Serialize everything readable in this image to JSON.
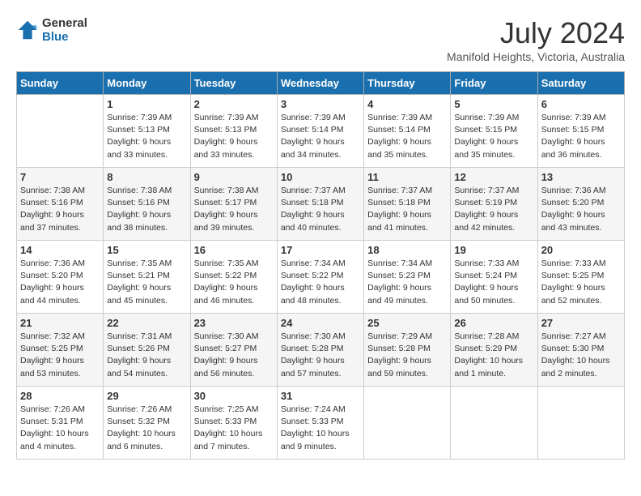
{
  "header": {
    "logo_line1": "General",
    "logo_line2": "Blue",
    "month_year": "July 2024",
    "location": "Manifold Heights, Victoria, Australia"
  },
  "days_of_week": [
    "Sunday",
    "Monday",
    "Tuesday",
    "Wednesday",
    "Thursday",
    "Friday",
    "Saturday"
  ],
  "weeks": [
    [
      {
        "day": "",
        "info": ""
      },
      {
        "day": "1",
        "info": "Sunrise: 7:39 AM\nSunset: 5:13 PM\nDaylight: 9 hours\nand 33 minutes."
      },
      {
        "day": "2",
        "info": "Sunrise: 7:39 AM\nSunset: 5:13 PM\nDaylight: 9 hours\nand 33 minutes."
      },
      {
        "day": "3",
        "info": "Sunrise: 7:39 AM\nSunset: 5:14 PM\nDaylight: 9 hours\nand 34 minutes."
      },
      {
        "day": "4",
        "info": "Sunrise: 7:39 AM\nSunset: 5:14 PM\nDaylight: 9 hours\nand 35 minutes."
      },
      {
        "day": "5",
        "info": "Sunrise: 7:39 AM\nSunset: 5:15 PM\nDaylight: 9 hours\nand 35 minutes."
      },
      {
        "day": "6",
        "info": "Sunrise: 7:39 AM\nSunset: 5:15 PM\nDaylight: 9 hours\nand 36 minutes."
      }
    ],
    [
      {
        "day": "7",
        "info": "Sunrise: 7:38 AM\nSunset: 5:16 PM\nDaylight: 9 hours\nand 37 minutes."
      },
      {
        "day": "8",
        "info": "Sunrise: 7:38 AM\nSunset: 5:16 PM\nDaylight: 9 hours\nand 38 minutes."
      },
      {
        "day": "9",
        "info": "Sunrise: 7:38 AM\nSunset: 5:17 PM\nDaylight: 9 hours\nand 39 minutes."
      },
      {
        "day": "10",
        "info": "Sunrise: 7:37 AM\nSunset: 5:18 PM\nDaylight: 9 hours\nand 40 minutes."
      },
      {
        "day": "11",
        "info": "Sunrise: 7:37 AM\nSunset: 5:18 PM\nDaylight: 9 hours\nand 41 minutes."
      },
      {
        "day": "12",
        "info": "Sunrise: 7:37 AM\nSunset: 5:19 PM\nDaylight: 9 hours\nand 42 minutes."
      },
      {
        "day": "13",
        "info": "Sunrise: 7:36 AM\nSunset: 5:20 PM\nDaylight: 9 hours\nand 43 minutes."
      }
    ],
    [
      {
        "day": "14",
        "info": "Sunrise: 7:36 AM\nSunset: 5:20 PM\nDaylight: 9 hours\nand 44 minutes."
      },
      {
        "day": "15",
        "info": "Sunrise: 7:35 AM\nSunset: 5:21 PM\nDaylight: 9 hours\nand 45 minutes."
      },
      {
        "day": "16",
        "info": "Sunrise: 7:35 AM\nSunset: 5:22 PM\nDaylight: 9 hours\nand 46 minutes."
      },
      {
        "day": "17",
        "info": "Sunrise: 7:34 AM\nSunset: 5:22 PM\nDaylight: 9 hours\nand 48 minutes."
      },
      {
        "day": "18",
        "info": "Sunrise: 7:34 AM\nSunset: 5:23 PM\nDaylight: 9 hours\nand 49 minutes."
      },
      {
        "day": "19",
        "info": "Sunrise: 7:33 AM\nSunset: 5:24 PM\nDaylight: 9 hours\nand 50 minutes."
      },
      {
        "day": "20",
        "info": "Sunrise: 7:33 AM\nSunset: 5:25 PM\nDaylight: 9 hours\nand 52 minutes."
      }
    ],
    [
      {
        "day": "21",
        "info": "Sunrise: 7:32 AM\nSunset: 5:25 PM\nDaylight: 9 hours\nand 53 minutes."
      },
      {
        "day": "22",
        "info": "Sunrise: 7:31 AM\nSunset: 5:26 PM\nDaylight: 9 hours\nand 54 minutes."
      },
      {
        "day": "23",
        "info": "Sunrise: 7:30 AM\nSunset: 5:27 PM\nDaylight: 9 hours\nand 56 minutes."
      },
      {
        "day": "24",
        "info": "Sunrise: 7:30 AM\nSunset: 5:28 PM\nDaylight: 9 hours\nand 57 minutes."
      },
      {
        "day": "25",
        "info": "Sunrise: 7:29 AM\nSunset: 5:28 PM\nDaylight: 9 hours\nand 59 minutes."
      },
      {
        "day": "26",
        "info": "Sunrise: 7:28 AM\nSunset: 5:29 PM\nDaylight: 10 hours\nand 1 minute."
      },
      {
        "day": "27",
        "info": "Sunrise: 7:27 AM\nSunset: 5:30 PM\nDaylight: 10 hours\nand 2 minutes."
      }
    ],
    [
      {
        "day": "28",
        "info": "Sunrise: 7:26 AM\nSunset: 5:31 PM\nDaylight: 10 hours\nand 4 minutes."
      },
      {
        "day": "29",
        "info": "Sunrise: 7:26 AM\nSunset: 5:32 PM\nDaylight: 10 hours\nand 6 minutes."
      },
      {
        "day": "30",
        "info": "Sunrise: 7:25 AM\nSunset: 5:33 PM\nDaylight: 10 hours\nand 7 minutes."
      },
      {
        "day": "31",
        "info": "Sunrise: 7:24 AM\nSunset: 5:33 PM\nDaylight: 10 hours\nand 9 minutes."
      },
      {
        "day": "",
        "info": ""
      },
      {
        "day": "",
        "info": ""
      },
      {
        "day": "",
        "info": ""
      }
    ]
  ]
}
